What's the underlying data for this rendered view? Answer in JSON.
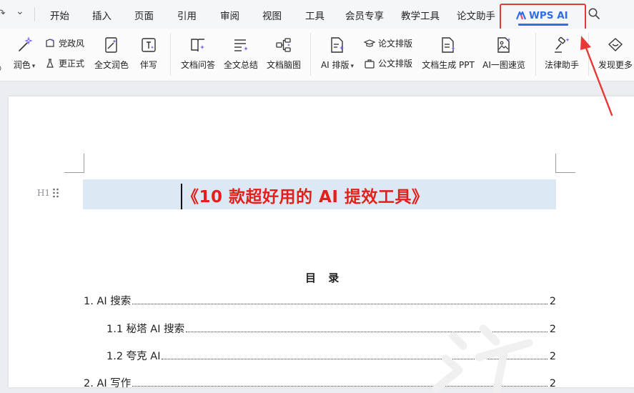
{
  "menubar": {
    "undo_glyph": "↷",
    "dropdown_glyph": "⌄",
    "tabs": [
      "开始",
      "插入",
      "页面",
      "引用",
      "审阅",
      "视图",
      "工具",
      "会员专享",
      "教学工具",
      "论文助手"
    ],
    "active_tab": "WPS AI"
  },
  "ribbon": {
    "polish": "润色",
    "party_style": "党政风",
    "more_formal": "更正式",
    "full_polish": "全文润色",
    "co_write": "伴写",
    "doc_qa": "文档问答",
    "full_summary": "全文总结",
    "mind_map": "文档脑图",
    "ai_layout": "AI 排版",
    "thesis_layout": "论文排版",
    "official_layout": "公文排版",
    "gen_ppt": "文档生成 PPT",
    "ai_image_read": "AI一图速览",
    "legal_assistant": "法律助手",
    "discover_more": "发现更多"
  },
  "document": {
    "heading_marker": "H1",
    "title": "《10 款超好用的 AI 提效工具》",
    "toc_heading": "目 录",
    "toc": [
      {
        "text": "1. AI 搜索",
        "page": "2"
      },
      {
        "text": "1.1 秘塔 AI 搜索",
        "page": "2"
      },
      {
        "text": "1.2 夸克 AI",
        "page": "2"
      },
      {
        "text": "2. AI 写作",
        "page": "2"
      }
    ]
  },
  "colors": {
    "accent_blue": "#2f6ee5",
    "highlight_red": "#e53935",
    "title_red": "#e3201b",
    "title_band": "#dde8f5"
  }
}
